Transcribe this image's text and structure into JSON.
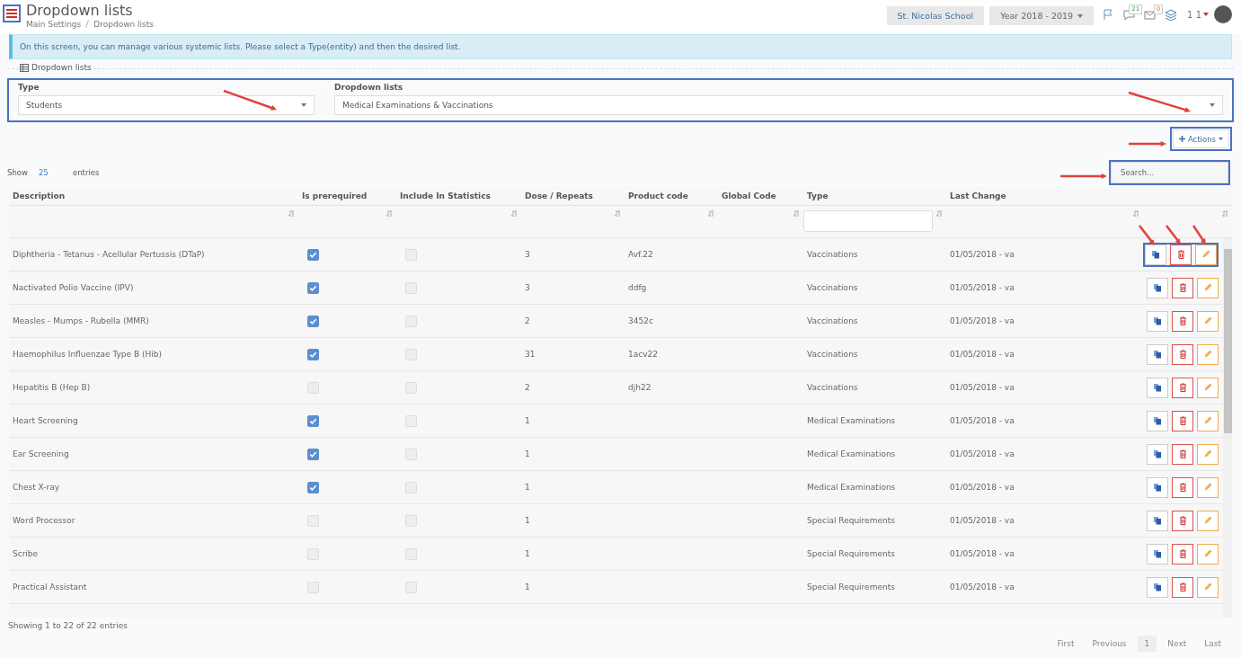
{
  "header": {
    "title": "Dropdown lists",
    "breadcrumb": [
      "Main Settings",
      "Dropdown lists"
    ],
    "school": "St. Nicolas School",
    "year": "Year 2018 - 2019",
    "notifications": "21",
    "messages": "0",
    "user": "1 1"
  },
  "info": "On this screen, you can manage various systemic lists. Please select a Type(entity) and then the desired list.",
  "panel": {
    "legend": "Dropdown lists",
    "type_label": "Type",
    "type_value": "Students",
    "list_label": "Dropdown lists",
    "list_value": "Medical Examinations & Vaccinations"
  },
  "actions_button": "Actions",
  "length": {
    "show": "Show",
    "value": "25",
    "entries": "entries"
  },
  "search": {
    "placeholder": "Search..."
  },
  "table": {
    "columns": [
      "Description",
      "Is prerequired",
      "Include In Statistics",
      "Dose / Repeats",
      "Product code",
      "Global Code",
      "Type",
      "Last Change"
    ],
    "rows": [
      {
        "description": "Diphtheria - Tetanus - Acellular Pertussis (DTaP)",
        "prerequired": true,
        "statistics": false,
        "dose": "3",
        "product": "Avf.22",
        "type": "Vaccinations",
        "changed": "01/05/2018 - va"
      },
      {
        "description": "Nactivated Polio Vaccine (IPV)",
        "prerequired": true,
        "statistics": false,
        "dose": "3",
        "product": "ddfg",
        "type": "Vaccinations",
        "changed": "01/05/2018 - va"
      },
      {
        "description": "Measles - Mumps - Rubella (MMR)",
        "prerequired": true,
        "statistics": false,
        "dose": "2",
        "product": "3452c",
        "type": "Vaccinations",
        "changed": "01/05/2018 - va"
      },
      {
        "description": "Haemophilus Influenzae Type B (Hib)",
        "prerequired": true,
        "statistics": false,
        "dose": "31",
        "product": "1acv22",
        "type": "Vaccinations",
        "changed": "01/05/2018 - va"
      },
      {
        "description": "Hepatitis B (Hep B)",
        "prerequired": false,
        "statistics": false,
        "dose": "2",
        "product": "djh22",
        "type": "Vaccinations",
        "changed": "01/05/2018 - va"
      },
      {
        "description": "Heart Screening",
        "prerequired": true,
        "statistics": false,
        "dose": "1",
        "type": "Medical Examinations",
        "changed": "01/05/2018 - va"
      },
      {
        "description": "Ear Screening",
        "prerequired": true,
        "statistics": false,
        "dose": "1",
        "type": "Medical Examinations",
        "changed": "01/05/2018 - va"
      },
      {
        "description": "Chest X-ray",
        "prerequired": true,
        "statistics": false,
        "dose": "1",
        "type": "Medical Examinations",
        "changed": "01/05/2018 - va"
      },
      {
        "description": "Word Processor",
        "prerequired": false,
        "statistics": false,
        "dose": "1",
        "type": "Special Requirements",
        "changed": "01/05/2018 - va"
      },
      {
        "description": "Scribe",
        "prerequired": false,
        "statistics": false,
        "dose": "1",
        "type": "Special Requirements",
        "changed": "01/05/2018 - va"
      },
      {
        "description": "Practical Assistant",
        "prerequired": false,
        "statistics": false,
        "dose": "1",
        "type": "Special Requirements",
        "changed": "01/05/2018 - va"
      }
    ]
  },
  "summary": "Showing 1 to 22 of 22 entries",
  "pagination": [
    {
      "label": "First",
      "selected": false
    },
    {
      "label": "Previous",
      "selected": false
    },
    {
      "label": "1",
      "selected": true
    },
    {
      "label": "Next",
      "selected": false
    },
    {
      "label": "Last",
      "selected": false
    }
  ]
}
